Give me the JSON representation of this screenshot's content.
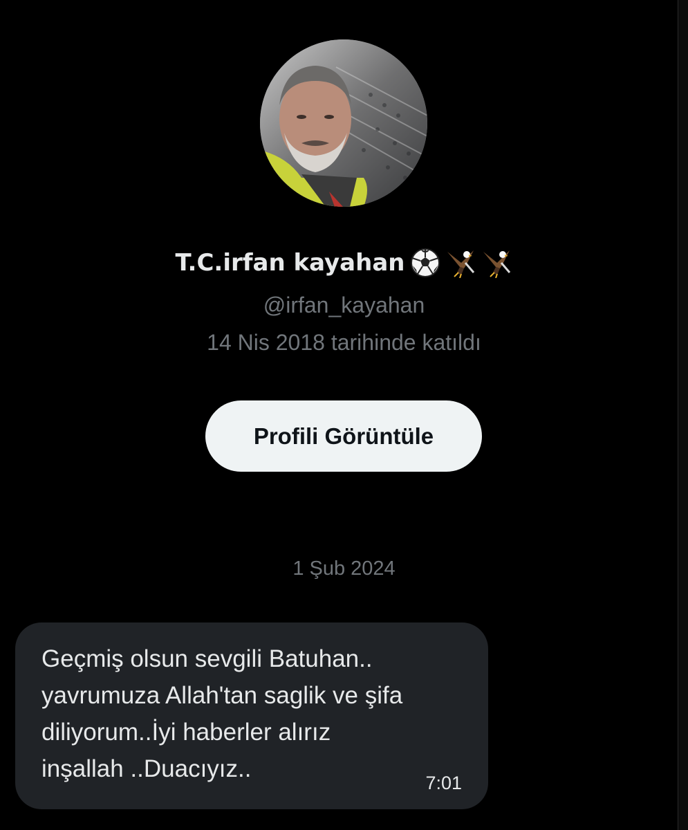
{
  "profile": {
    "display_name": "T.C.irfan kayahan",
    "name_emojis": [
      "soccer-ball",
      "eagle",
      "eagle"
    ],
    "handle": "@irfan_kayahan",
    "joined": "14 Nis 2018 tarihinde katıldı",
    "view_profile_label": "Profili Görüntüle"
  },
  "conversation": {
    "date_separator": "1 Şub 2024",
    "messages": [
      {
        "text": "Geçmiş olsun sevgili Batuhan..\nyavrumuza Allah'tan saglik ve şifa\ndiliyorum..İyi haberler alırız\ninşallah ..Duacıyız..",
        "time": "7:01"
      }
    ]
  },
  "colors": {
    "background": "#000000",
    "primary_text": "#e7e9ea",
    "secondary_text": "#71767b",
    "button_bg": "#eff3f4",
    "bubble_bg": "#202327"
  }
}
